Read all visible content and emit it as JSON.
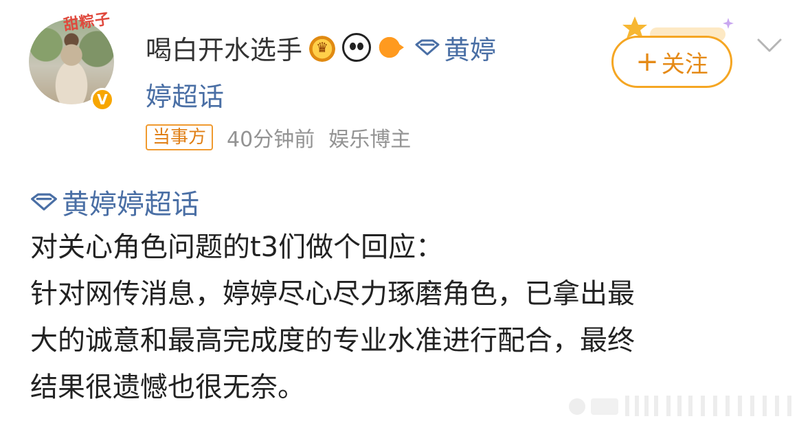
{
  "author": {
    "username": "喝白开水选手",
    "avatar_sticker_text": "甜粽子",
    "badges": [
      "crown-badge-icon",
      "panda-badge-icon",
      "fish-badge-icon"
    ],
    "supertopic_line1": "黄婷",
    "supertopic_line2": "婷超话",
    "party_tag": "当事方",
    "time": "40分钟前",
    "category": "娱乐博主"
  },
  "actions": {
    "follow_plus": "+",
    "follow_label": "关注"
  },
  "post": {
    "topic": "黄婷婷超话",
    "lines": [
      "对关心角色问题的t3们做个回应：",
      "针对网传消息，婷婷尽心尽力琢磨角色，已拿出最",
      "大的诚意和最高完成度的专业水准进行配合，最终",
      "结果很遗憾也很无奈。"
    ]
  },
  "colors": {
    "accent_orange": "#f5a623",
    "topic_blue": "#4a6fa5",
    "meta_gray": "#939393",
    "verified": "#f7a600"
  }
}
